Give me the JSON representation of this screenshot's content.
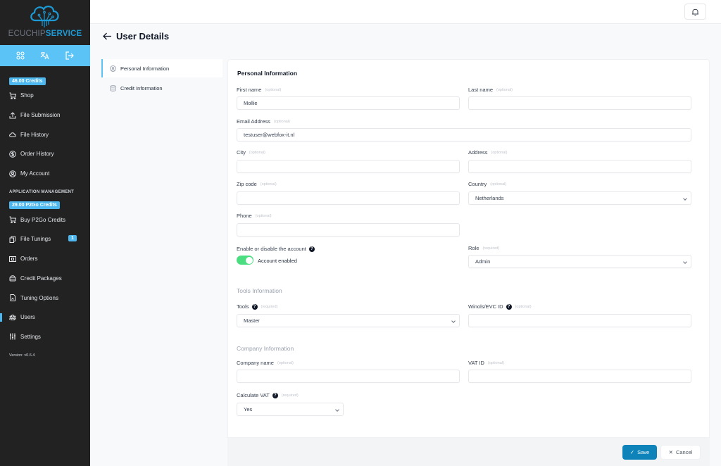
{
  "brand": {
    "name_part1": "ECUCHIP",
    "name_part2": "SERVICE",
    "accent": "#1b9ad6"
  },
  "sidebar": {
    "quick_icons": [
      "apps-icon",
      "translate-icon",
      "logout-icon"
    ],
    "credits_badge": "46.00 Credits",
    "items": [
      {
        "label": "Shop",
        "icon": "cart-icon"
      },
      {
        "label": "File Submission",
        "icon": "upload-icon"
      },
      {
        "label": "File History",
        "icon": "cloud-icon"
      },
      {
        "label": "Order History",
        "icon": "dollar-icon"
      },
      {
        "label": "My Account",
        "icon": "account-icon"
      }
    ],
    "section_title": "APPLICATION MANAGEMENT",
    "p2go_badge": "29.00 P2Go Credits",
    "admin_items": [
      {
        "label": "Buy P2Go Credits",
        "icon": "cart-icon"
      },
      {
        "label": "File Tunings",
        "icon": "files-icon",
        "count": "1"
      },
      {
        "label": "Orders",
        "icon": "orders-icon"
      },
      {
        "label": "Credit Packages",
        "icon": "package-icon"
      },
      {
        "label": "Tuning Options",
        "icon": "document-icon"
      },
      {
        "label": "Users",
        "icon": "users-icon",
        "active": true
      },
      {
        "label": "Settings",
        "icon": "sliders-icon"
      }
    ],
    "version": "Version: v0.6.4"
  },
  "page": {
    "title": "User Details",
    "tabs": [
      {
        "label": "Personal Information",
        "active": true
      },
      {
        "label": "Credit Information",
        "active": false
      }
    ]
  },
  "form": {
    "title": "Personal Information",
    "first_name": {
      "label": "First name",
      "hint": "(optional)",
      "value": "Mollie"
    },
    "last_name": {
      "label": "Last name",
      "hint": "(optional)",
      "value": ""
    },
    "email": {
      "label": "Email Address",
      "hint": "(optional)",
      "value": "testuser@webfox-it.nl"
    },
    "city": {
      "label": "City",
      "hint": "(optional)",
      "value": ""
    },
    "address": {
      "label": "Address",
      "hint": "(optional)",
      "value": ""
    },
    "zip": {
      "label": "Zip code",
      "hint": "(optional)",
      "value": ""
    },
    "country": {
      "label": "Country",
      "hint": "(optional)",
      "value": "Netherlands"
    },
    "phone": {
      "label": "Phone",
      "hint": "(optional)",
      "value": ""
    },
    "account_toggle": {
      "label": "Enable or disable the account",
      "state_label": "Account enabled",
      "enabled": true
    },
    "role": {
      "label": "Role",
      "hint": "(required)",
      "value": "Admin"
    },
    "tools_section": "Tools Information",
    "tools": {
      "label": "Tools",
      "hint": "(required)",
      "value": "Master"
    },
    "winols": {
      "label": "Winols/EVC ID",
      "hint": "(optional)",
      "value": ""
    },
    "company_section": "Company Information",
    "company_name": {
      "label": "Company name",
      "hint": "(optional)",
      "value": ""
    },
    "vat_id": {
      "label": "VAT ID",
      "hint": "(optional)",
      "value": ""
    },
    "calc_vat": {
      "label": "Calculate VAT",
      "hint": "(required)",
      "value": "Yes"
    }
  },
  "actions": {
    "save": "Save",
    "cancel": "Cancel"
  }
}
